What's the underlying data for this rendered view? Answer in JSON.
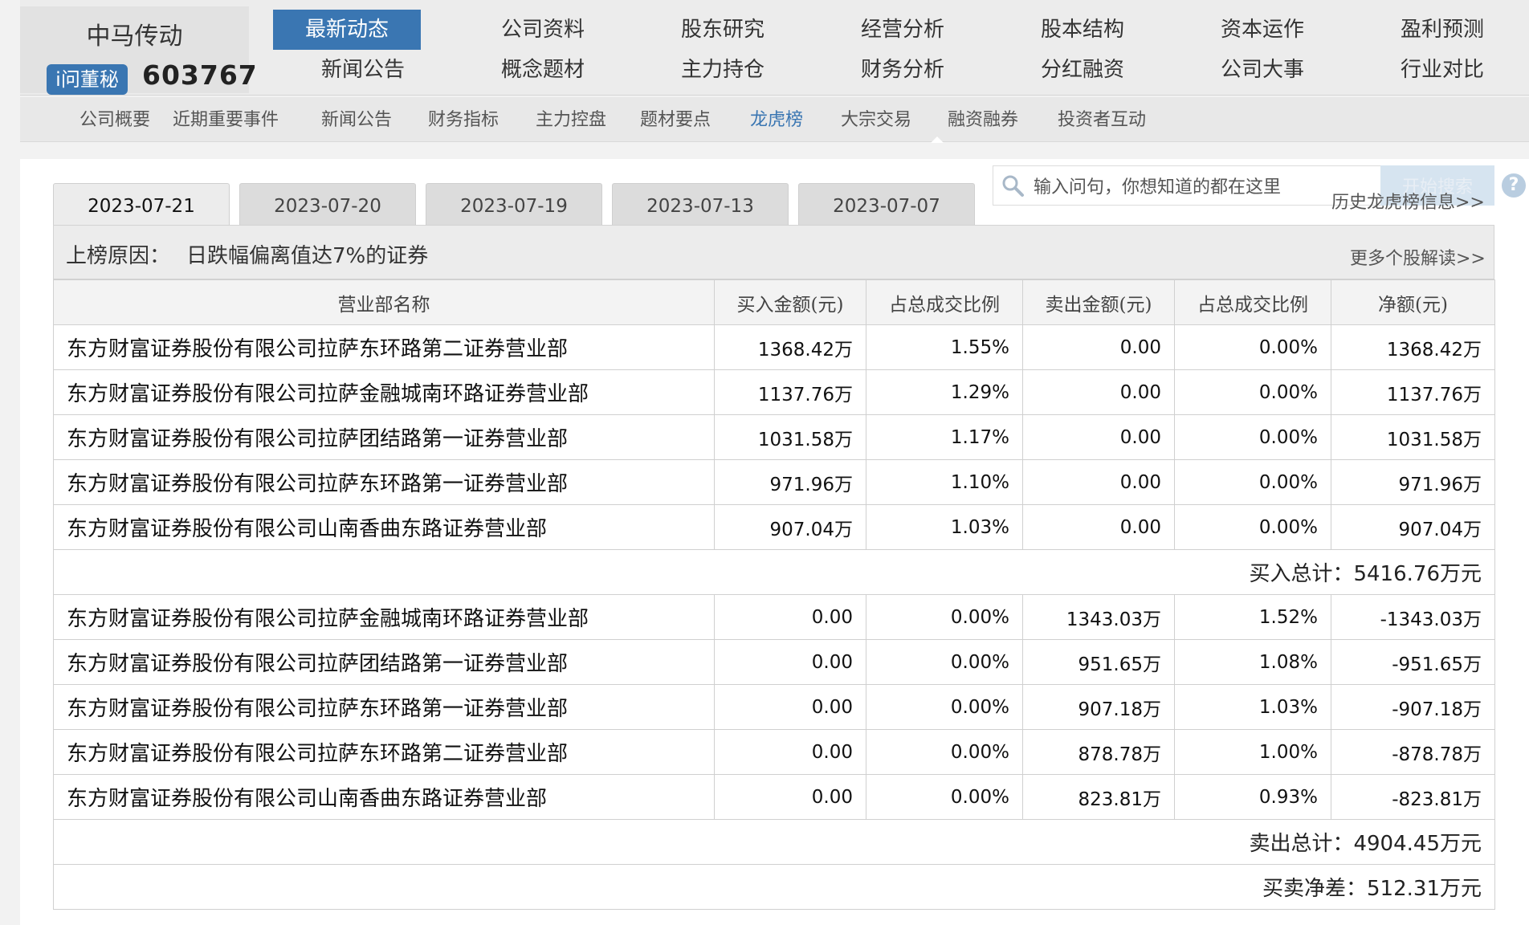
{
  "brand": {
    "name": "中马传动",
    "badge": "i问董秘",
    "code": "603767"
  },
  "nav": {
    "items": [
      "最新动态",
      "公司资料",
      "股东研究",
      "经营分析",
      "股本结构",
      "资本运作",
      "盈利预测",
      "新闻公告",
      "概念题材",
      "主力持仓",
      "财务分析",
      "分红融资",
      "公司大事",
      "行业对比"
    ],
    "active_index": 0
  },
  "subnav": {
    "items": [
      "公司概要",
      "近期重要事件",
      "新闻公告",
      "财务指标",
      "主力控盘",
      "题材要点",
      "龙虎榜",
      "大宗交易",
      "融资融券",
      "投资者互动"
    ],
    "active_index": 6
  },
  "tabs": [
    "2023-07-21",
    "2023-07-20",
    "2023-07-19",
    "2023-07-13",
    "2023-07-07"
  ],
  "active_tab": 0,
  "search": {
    "placeholder": "输入问句，你想知道的都在这里",
    "button": "开始搜索",
    "help": "?"
  },
  "history_link": "历史龙虎榜信息>>",
  "reason": {
    "label": "上榜原因：",
    "text": "日跌幅偏离值达7%的证券",
    "more": "更多个股解读>>"
  },
  "table": {
    "headers": [
      "营业部名称",
      "买入金额(元)",
      "占总成交比例",
      "卖出金额(元)",
      "占总成交比例",
      "净额(元)"
    ],
    "buy_rows": [
      [
        "东方财富证券股份有限公司拉萨东环路第二证券营业部",
        "1368.42万",
        "1.55%",
        "0.00",
        "0.00%",
        "1368.42万"
      ],
      [
        "东方财富证券股份有限公司拉萨金融城南环路证券营业部",
        "1137.76万",
        "1.29%",
        "0.00",
        "0.00%",
        "1137.76万"
      ],
      [
        "东方财富证券股份有限公司拉萨团结路第一证券营业部",
        "1031.58万",
        "1.17%",
        "0.00",
        "0.00%",
        "1031.58万"
      ],
      [
        "东方财富证券股份有限公司拉萨东环路第一证券营业部",
        "971.96万",
        "1.10%",
        "0.00",
        "0.00%",
        "971.96万"
      ],
      [
        "东方财富证券股份有限公司山南香曲东路证券营业部",
        "907.04万",
        "1.03%",
        "0.00",
        "0.00%",
        "907.04万"
      ]
    ],
    "buy_total": "买入总计：5416.76万元",
    "sell_rows": [
      [
        "东方财富证券股份有限公司拉萨金融城南环路证券营业部",
        "0.00",
        "0.00%",
        "1343.03万",
        "1.52%",
        "-1343.03万"
      ],
      [
        "东方财富证券股份有限公司拉萨团结路第一证券营业部",
        "0.00",
        "0.00%",
        "951.65万",
        "1.08%",
        "-951.65万"
      ],
      [
        "东方财富证券股份有限公司拉萨东环路第一证券营业部",
        "0.00",
        "0.00%",
        "907.18万",
        "1.03%",
        "-907.18万"
      ],
      [
        "东方财富证券股份有限公司拉萨东环路第二证券营业部",
        "0.00",
        "0.00%",
        "878.78万",
        "1.00%",
        "-878.78万"
      ],
      [
        "东方财富证券股份有限公司山南香曲东路证券营业部",
        "0.00",
        "0.00%",
        "823.81万",
        "0.93%",
        "-823.81万"
      ]
    ],
    "sell_total": "卖出总计：4904.45万元",
    "net_diff": "买卖净差：512.31万元"
  },
  "colors": {
    "accent": "#3a76b2"
  }
}
